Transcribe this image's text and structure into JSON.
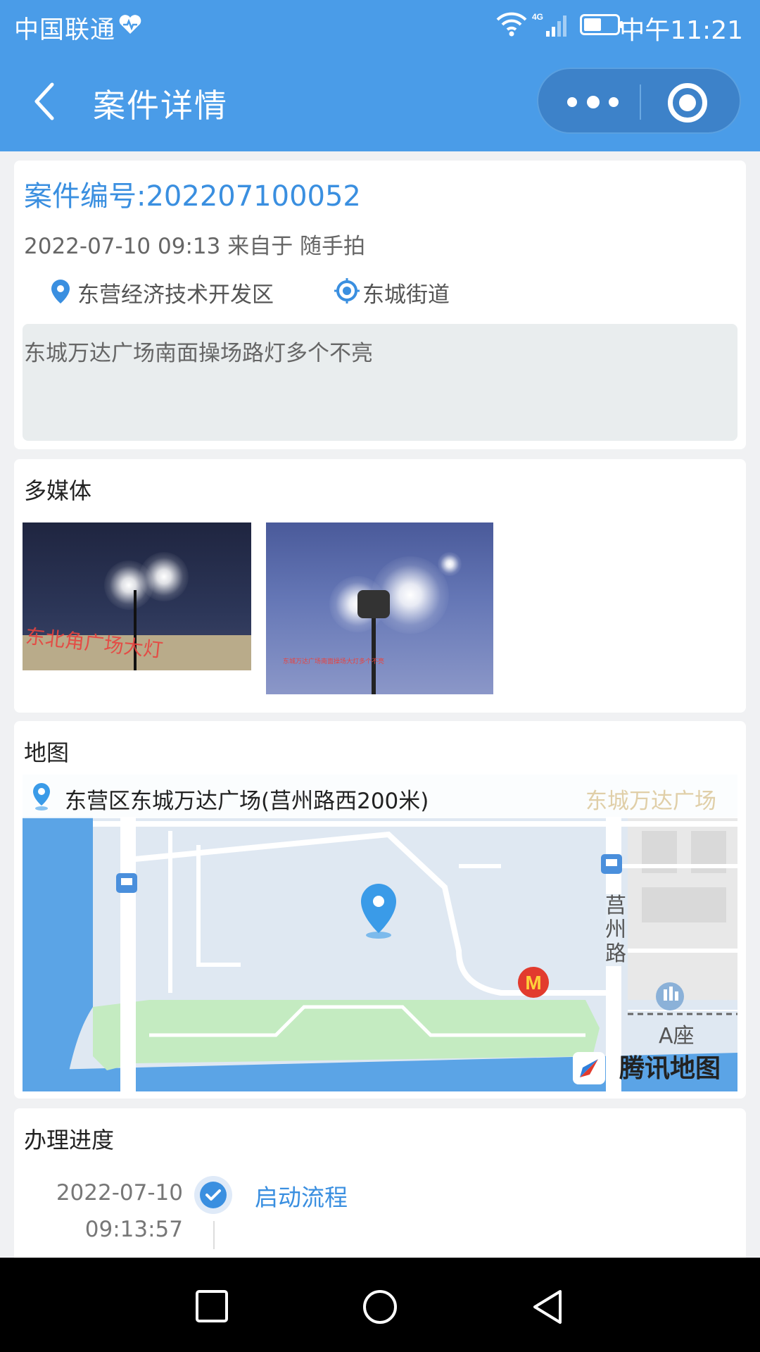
{
  "status_bar": {
    "carrier": "中国联通",
    "network": "4G",
    "time": "中午11:21"
  },
  "header": {
    "title": "案件详情",
    "icons": [
      "back-icon",
      "more-icon",
      "close-icon"
    ]
  },
  "case": {
    "number_label": "案件编号:202207100052",
    "meta": "2022-07-10 09:13 来自于 随手拍",
    "district": "东营经济技术开发区",
    "street": "东城街道",
    "description": "东城万达广场南面操场路灯多个不亮"
  },
  "media": {
    "title": "多媒体",
    "photos": [
      {
        "caption": "东北角广场大灯"
      },
      {
        "caption": "东城万达广场南面操场大灯多个不亮"
      }
    ]
  },
  "map": {
    "title": "地图",
    "address": "东营区东城万达广场(莒州路西200米)",
    "poi_top_right": "东城万达广场",
    "road_label": "莒州路",
    "building_label": "A座",
    "brand": "腾讯地图",
    "colors": {
      "water": "#5ba4e6",
      "park": "#c4ebc1",
      "land": "#dfe8f2",
      "road": "#ffffff"
    }
  },
  "progress": {
    "title": "办理进度",
    "steps": [
      {
        "date": "2022-07-10",
        "time": "09:13:57",
        "label": "启动流程",
        "status": "done"
      }
    ]
  },
  "colors": {
    "accent": "#3a8fe0",
    "header_bg": "#4a9ce8"
  }
}
